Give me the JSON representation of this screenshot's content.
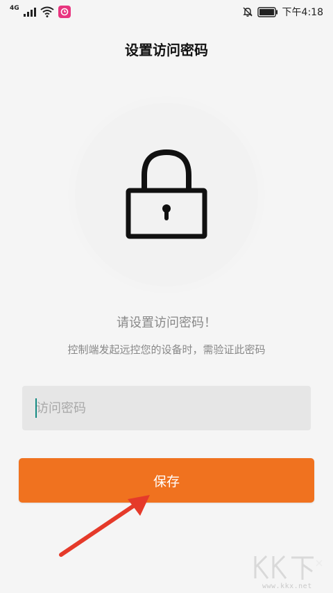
{
  "status_bar": {
    "network_label": "4G",
    "time": "下午4:18",
    "icons": [
      "signal-icon",
      "wifi-icon",
      "app-badge-icon",
      "bell-off-icon",
      "battery-icon"
    ]
  },
  "header": {
    "title": "设置访问密码"
  },
  "illustration": {
    "icon": "lock-icon"
  },
  "message": {
    "title": "请设置访问密码！",
    "subtitle": "控制端发起远控您的设备时，需验证此密码"
  },
  "password_field": {
    "placeholder": "访问密码",
    "value": ""
  },
  "actions": {
    "save_label": "保存"
  },
  "watermark": {
    "text": "www.kkx.net",
    "logo_text": "KK下载"
  },
  "colors": {
    "background": "#f5f5f5",
    "accent": "#f0721f",
    "input_bg": "#e6e6e6",
    "caret": "#138a82",
    "arrow": "#e53a2a"
  }
}
